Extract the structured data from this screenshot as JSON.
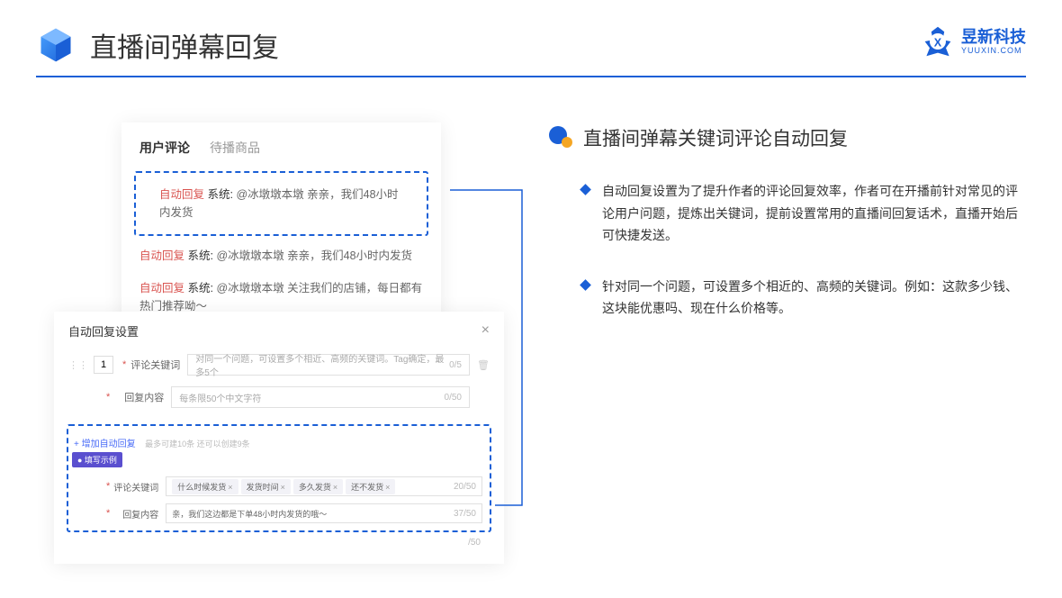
{
  "header": {
    "title": "直播间弹幕回复",
    "logo_cn": "昱新科技",
    "logo_en": "YUUXIN.COM"
  },
  "panelTop": {
    "tabs": {
      "a": "用户评论",
      "b": "待播商品"
    },
    "c1": {
      "tag": "自动回复",
      "sys": "系统:",
      "text": "@冰墩墩本墩 亲亲，我们48小时内发货"
    },
    "c2": {
      "tag": "自动回复",
      "sys": "系统:",
      "text": "@冰墩墩本墩 亲亲，我们48小时内发货"
    },
    "c3": {
      "tag": "自动回复",
      "sys": "系统:",
      "text": "@冰墩墩本墩 关注我们的店铺，每日都有热门推荐呦～"
    }
  },
  "panelBottom": {
    "title": "自动回复设置",
    "num": "1",
    "label_kw": "评论关键词",
    "ph_kw": "对同一个问题，可设置多个相近、高频的关键词。Tag确定，最多5个",
    "kw_count": "0/5",
    "label_reply": "回复内容",
    "ph_reply": "每条限50个中文字符",
    "reply_count": "0/50",
    "add_text": "+ 增加自动回复",
    "add_hint": "最多可建10条 还可以创建9条",
    "badge": "● 填写示例",
    "ex_label_kw": "评论关键词",
    "ex_tags": [
      "什么时候发货",
      "发货时间",
      "多久发货",
      "还不发货"
    ],
    "ex_kw_count": "20/50",
    "ex_label_reply": "回复内容",
    "ex_reply": "亲，我们这边都是下单48小时内发货的哦～",
    "ex_reply_count": "37/50",
    "outer_count": "/50"
  },
  "right": {
    "title": "直播间弹幕关键词评论自动回复",
    "p1": "自动回复设置为了提升作者的评论回复效率，作者可在开播前针对常见的评论用户问题，提炼出关键词，提前设置常用的直播间回复话术，直播开始后可快捷发送。",
    "p2": "针对同一个问题，可设置多个相近的、高频的关键词。例如：这款多少钱、这块能优惠吗、现在什么价格等。"
  }
}
